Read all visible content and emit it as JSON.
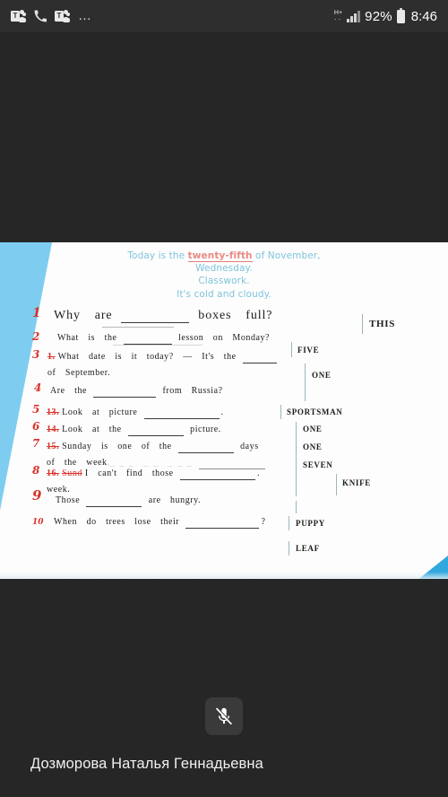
{
  "status_bar": {
    "left_icons": [
      "teams-icon",
      "phone-icon",
      "teams-icon",
      "overflow-dots-icon"
    ],
    "overflow_dots": "…",
    "network_type_top": "H+",
    "network_type_bottom": "…",
    "signal_icon": "signal-bars-icon",
    "battery_percent": "92%",
    "battery_icon": "battery-icon",
    "clock": "8:46"
  },
  "shared_document": {
    "header": {
      "line1_before": "Today is the ",
      "line1_highlight": "twenty-fifth",
      "line1_after": " of November,",
      "line2": "Wednesday.",
      "line3": "Classwork.",
      "line4": "It's cold and cloudy.",
      "text_color": "#7fc4dd",
      "highlight_color": "#e98a84"
    },
    "exercises": [
      {
        "hand_number": "1",
        "printed_number": "",
        "text": "Why are _________ boxes full?",
        "answer": "THIS"
      },
      {
        "hand_number": "2",
        "printed_number": "",
        "text": "What is the _______ lesson on Monday?",
        "answer": "FIVE"
      },
      {
        "hand_number": "3",
        "printed_number": "1.",
        "text": "What date is it today? — It's the ______ of September.",
        "answer": "ONE"
      },
      {
        "hand_number": "4",
        "printed_number": "",
        "text": "Are the ___________ from Russia?",
        "answer": "SPORTSMAN"
      },
      {
        "hand_number": "5",
        "printed_number": "13.",
        "text": "Look at picture ______________.",
        "answer": "ONE"
      },
      {
        "hand_number": "6",
        "printed_number": "14.",
        "text": "Look at the __________ picture.",
        "answer": "ONE"
      },
      {
        "hand_number": "7",
        "printed_number": "15.",
        "text": "Sunday is one of the __________ days of the week.",
        "answer": "SEVEN"
      },
      {
        "hand_number": "8",
        "printed_number": "16.",
        "overlap_ghost": "Sund",
        "text": "I can't find those _____________. week.",
        "answer": "KNIFE"
      },
      {
        "hand_number": "9",
        "printed_number": "",
        "text": "Those __________ are hungry.",
        "answer": "PUPPY"
      },
      {
        "hand_number": "10",
        "printed_number": "",
        "text": "When do trees lose their ______________?",
        "answer": "LEAF"
      }
    ],
    "accent_color": "#7ecdf0",
    "hand_ink_color": "#d8322c"
  },
  "call_controls": {
    "mic_icon": "microphone-muted-icon",
    "mic_state": "muted"
  },
  "participant": {
    "name": "Дозморова Наталья Геннадьевна"
  }
}
